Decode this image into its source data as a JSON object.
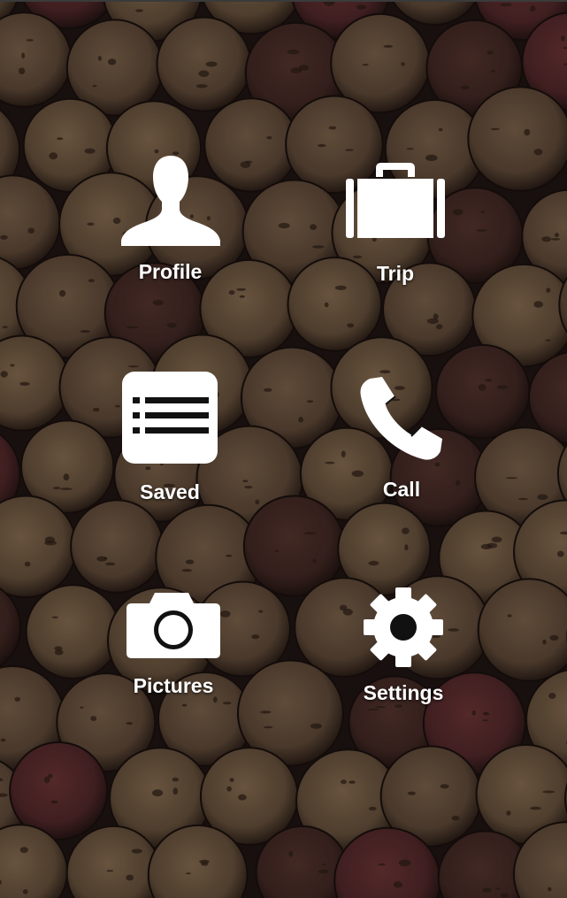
{
  "background": {
    "description_icon": "wine-corks-background",
    "shade_color": "#140c0a"
  },
  "menu": {
    "items": [
      {
        "id": "profile",
        "label": "Profile",
        "icon": "person-silhouette-icon"
      },
      {
        "id": "trip",
        "label": "Trip",
        "icon": "suitcase-icon"
      },
      {
        "id": "saved",
        "label": "Saved",
        "icon": "list-icon"
      },
      {
        "id": "call",
        "label": "Call",
        "icon": "phone-icon"
      },
      {
        "id": "pictures",
        "label": "Pictures",
        "icon": "camera-icon"
      },
      {
        "id": "settings",
        "label": "Settings",
        "icon": "gear-icon"
      }
    ],
    "text_color": "#ffffff",
    "icon_color": "#ffffff"
  }
}
